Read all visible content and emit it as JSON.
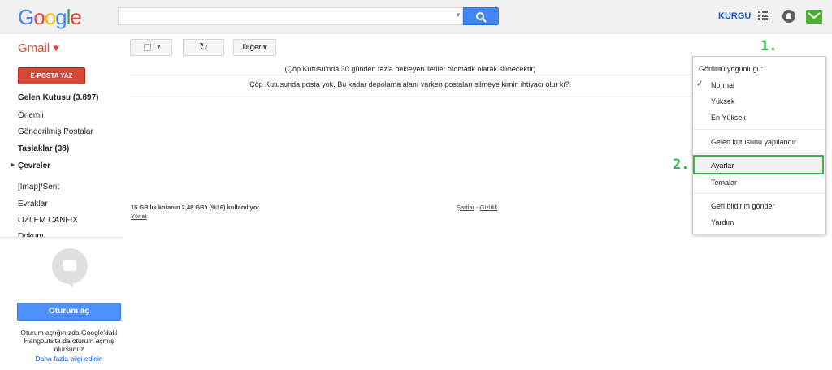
{
  "header": {
    "logo_letters": [
      {
        "char": "G",
        "color": "#4285f4"
      },
      {
        "char": "o",
        "color": "#ea4335"
      },
      {
        "char": "o",
        "color": "#fbbc05"
      },
      {
        "char": "g",
        "color": "#4285f4"
      },
      {
        "char": "l",
        "color": "#34a853"
      },
      {
        "char": "e",
        "color": "#ea4335"
      }
    ],
    "search_value": "",
    "user_name": "KURGU"
  },
  "toolbar": {
    "app_label": "Gmail ▾",
    "more_label": "Diğer ▾",
    "refresh_glyph": "↻",
    "settings_glyph": "⚙ ▾",
    "step1_label": "1."
  },
  "sidebar": {
    "compose_label": "E-POSTA YAZ",
    "items": [
      {
        "label": "Gelen Kutusu (3.897)",
        "bold": true
      },
      {
        "label": "Önemli",
        "bold": false
      },
      {
        "label": "Gönderilmiş Postalar",
        "bold": false
      },
      {
        "label": "Taslaklar (38)",
        "bold": true
      },
      {
        "label": "Çevreler",
        "bold": true
      },
      {
        "label": "[Imap]/Sent",
        "bold": false
      },
      {
        "label": "Evraklar",
        "bold": false
      },
      {
        "label": "OZLEM CANFIX",
        "bold": false
      },
      {
        "label": "Dokum",
        "bold": false
      }
    ],
    "hangouts": {
      "signin_label": "Oturum aç",
      "info_text": "Oturum açtığınızda Google'daki Hangouts'ta da oturum açmış olursunuz",
      "learn_more": "Daha fazla bilgi edinin"
    }
  },
  "main": {
    "trash_notice": "(Çöp Kutusu'nda 30 günden fazla bekleyen iletiler otomatik olarak silinecektir)",
    "empty_message": "Çöp Kutusunda posta yok. Bu kadar depolama alanı varken postaları silmeye kimin ihtiyacı olur ki?!",
    "storage_text": "15 GB'lık kotanın 2,48 GB'ı (%16) kullanılıyor",
    "manage_link": "Yönet",
    "terms_link": "Şartlar",
    "terms_sep": " - ",
    "privacy_link": "Gizlilik"
  },
  "settings_menu": {
    "density_label": "Görüntü yoğunluğu:",
    "check_glyph": "✓",
    "items": {
      "normal": "Normal",
      "yuksek": "Yüksek",
      "en_yuksek": "En Yüksek",
      "configure_inbox": "Gelen kutusunu yapılandır",
      "settings": "Ayarlar",
      "themes": "Temalar",
      "feedback": "Geri bildirim gönder",
      "help": "Yardım"
    },
    "step2_label": "2."
  },
  "colors": {
    "accent_green": "#3bb54a",
    "compose_red": "#d14836",
    "search_blue": "#4285f4",
    "link_blue": "#1155cc"
  }
}
